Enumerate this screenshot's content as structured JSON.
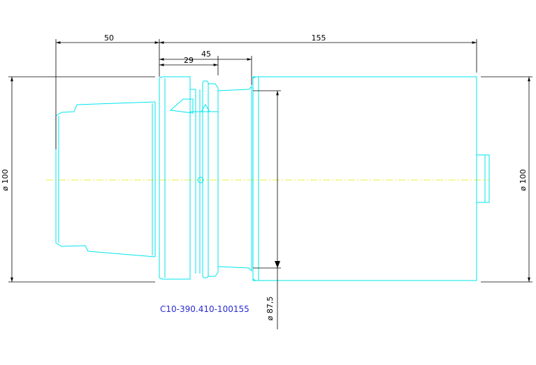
{
  "dimensions": {
    "length_left": "50",
    "length_overall": "155",
    "length_29": "29",
    "length_45": "45",
    "diameter_left": "ø 100",
    "diameter_right": "ø 100",
    "diameter_bore": "ø  87,5"
  },
  "part_number": "C10-390.410-100155",
  "colors": {
    "part_outline": "#00e5ee",
    "dimension_lines": "#000000",
    "centerline": "#e8e800",
    "part_number_text": "#2a2ad4"
  }
}
